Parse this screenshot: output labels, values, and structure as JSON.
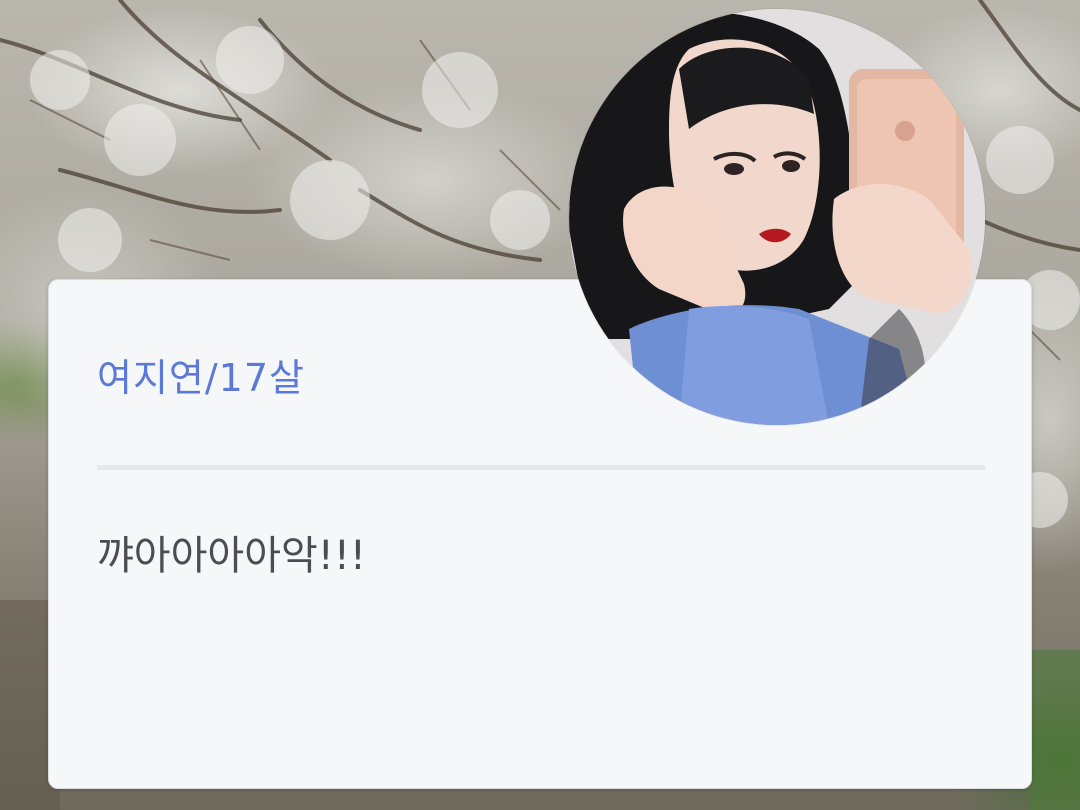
{
  "background": {
    "description_icon": "cherry-blossom-tree-photo"
  },
  "card": {
    "name_line": "여지연/17살",
    "message": "꺄아아아아악!!!"
  },
  "avatar": {
    "icon": "profile-photo-girl-with-phone"
  },
  "colors": {
    "name": "#5b79d8",
    "message": "#4a4d53",
    "card_bg": "#f6f7f9",
    "divider": "#e6e7ea"
  }
}
